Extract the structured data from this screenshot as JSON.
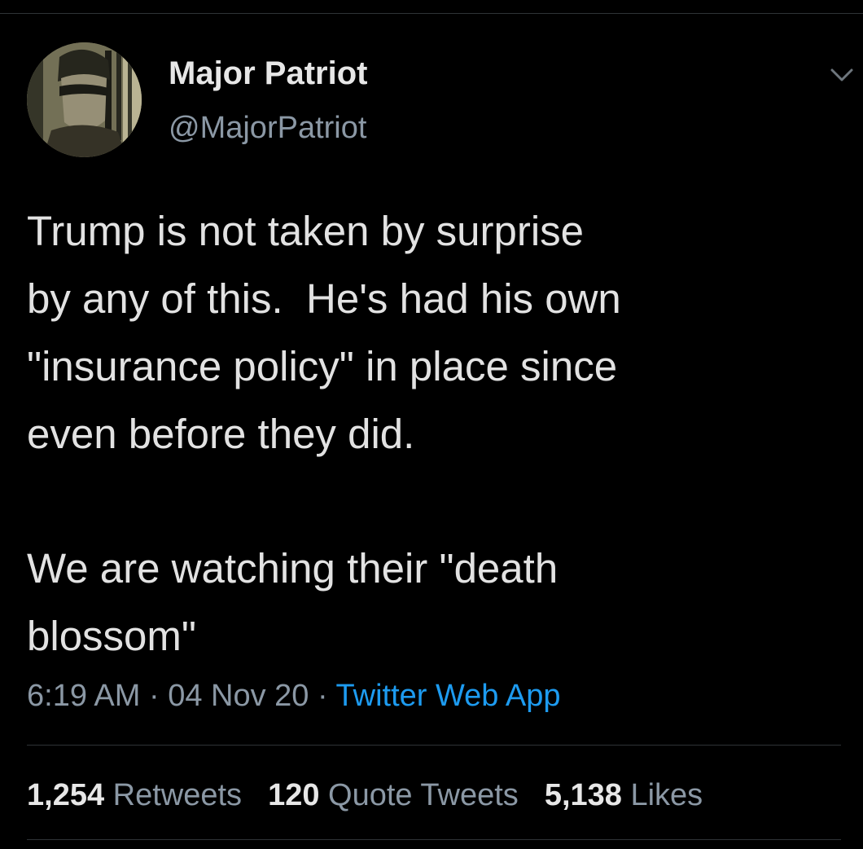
{
  "author": {
    "display_name": "Major Patriot",
    "handle": "@MajorPatriot",
    "avatar_icon": "profile-photo"
  },
  "menu": {
    "icon": "chevron-down-icon"
  },
  "tweet": {
    "lines": [
      "Trump is not taken by surprise",
      "by any of this.  He's had his own",
      "\"insurance policy\" in place since",
      "even before they did.",
      "We are watching their \"death",
      "blossom\""
    ]
  },
  "meta": {
    "time": "6:19 AM",
    "separator_1": " · ",
    "date": "04 Nov 20",
    "separator_2": " · ",
    "source": "Twitter Web App"
  },
  "stats": {
    "retweets_count": "1,254",
    "retweets_label": "Retweets",
    "quotes_count": "120",
    "quotes_label": "Quote Tweets",
    "likes_count": "5,138",
    "likes_label": "Likes"
  },
  "colors": {
    "background": "#000000",
    "text": "#e2e2e2",
    "secondary": "#8b98a5",
    "link": "#1d9bf0",
    "divider": "#2f3336"
  }
}
